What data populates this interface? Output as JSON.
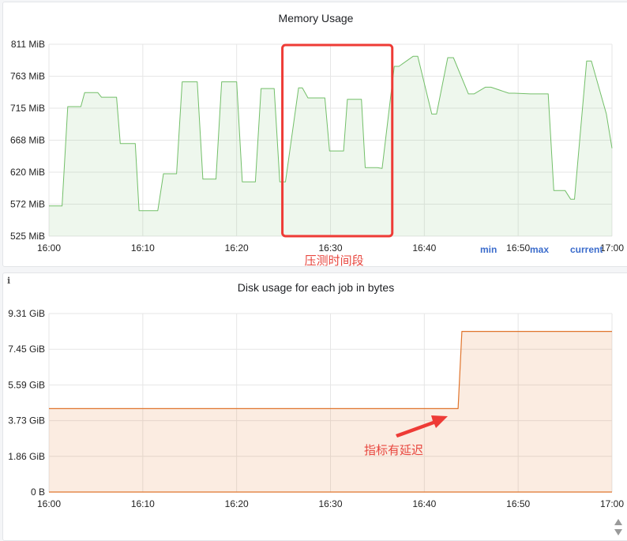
{
  "chart_data": [
    {
      "type": "area",
      "title": "Memory Usage",
      "x_ticks": [
        "16:00",
        "16:10",
        "16:20",
        "16:30",
        "16:40",
        "16:50",
        "17:00"
      ],
      "y_ticks": [
        "811 MiB",
        "763 MiB",
        "715 MiB",
        "668 MiB",
        "620 MiB",
        "572 MiB",
        "525 MiB"
      ],
      "xlim_minutes": [
        0,
        60
      ],
      "ylim": [
        525,
        811
      ],
      "color": "#73bf69",
      "grid": true,
      "series": [
        {
          "x": [
            0,
            1.4,
            2,
            3.4,
            3.8,
            5.2,
            5.6,
            7.2,
            7.6,
            9.2,
            9.6,
            11.2,
            11.6,
            12.2,
            13.6,
            14.2,
            15.8,
            16.4,
            17.8,
            18.4,
            20,
            20.6,
            22,
            22.6,
            24,
            24.6,
            25.2,
            26.6,
            27,
            27.6,
            28.2,
            29.4,
            29.9,
            31.4,
            31.8,
            33.3,
            33.7,
            35,
            35.5,
            36.8,
            37.3,
            38.8,
            39.3,
            40.8,
            41.3,
            42.5,
            43.1,
            44.7,
            45.3,
            46.5,
            47.1,
            49,
            49.6,
            51.3,
            51.9,
            52.4,
            53.2,
            53.8,
            55,
            55.6,
            56,
            57.3,
            57.8,
            59.4,
            60
          ],
          "y": [
            570,
            570,
            718,
            718,
            739,
            739,
            732,
            732,
            663,
            663,
            563,
            563,
            563,
            618,
            618,
            755,
            755,
            610,
            610,
            755,
            755,
            606,
            606,
            745,
            745,
            606,
            606,
            746,
            746,
            731,
            731,
            731,
            652,
            652,
            729,
            729,
            627,
            627,
            626,
            778,
            778,
            793,
            793,
            707,
            707,
            791,
            791,
            737,
            737,
            747,
            747,
            738,
            738,
            737,
            737,
            737,
            737,
            593,
            593,
            580,
            580,
            786,
            786,
            707,
            656
          ]
        }
      ],
      "annotation_box": {
        "x_range": [
          25,
          36.5
        ],
        "y_range": [
          525,
          811
        ]
      },
      "annotation_text": "压测时间段"
    },
    {
      "type": "area",
      "title": "Disk usage for each job in bytes",
      "x_ticks": [
        "16:00",
        "16:10",
        "16:20",
        "16:30",
        "16:40",
        "16:50",
        "17:00"
      ],
      "y_ticks": [
        "9.31 GiB",
        "7.45 GiB",
        "5.59 GiB",
        "3.73 GiB",
        "1.86 GiB",
        "0 B"
      ],
      "xlim_minutes": [
        0,
        60
      ],
      "ylim": [
        0,
        9.31
      ],
      "color": "#e0752d",
      "grid": true,
      "series": [
        {
          "x": [
            0,
            43.6,
            44,
            60
          ],
          "y": [
            4.35,
            4.35,
            8.38,
            8.38
          ]
        },
        {
          "x": [
            0,
            60
          ],
          "y": [
            0,
            0
          ]
        }
      ],
      "annotation_text": "指标有延迟",
      "legend": [
        "min",
        "max",
        "current"
      ]
    }
  ]
}
